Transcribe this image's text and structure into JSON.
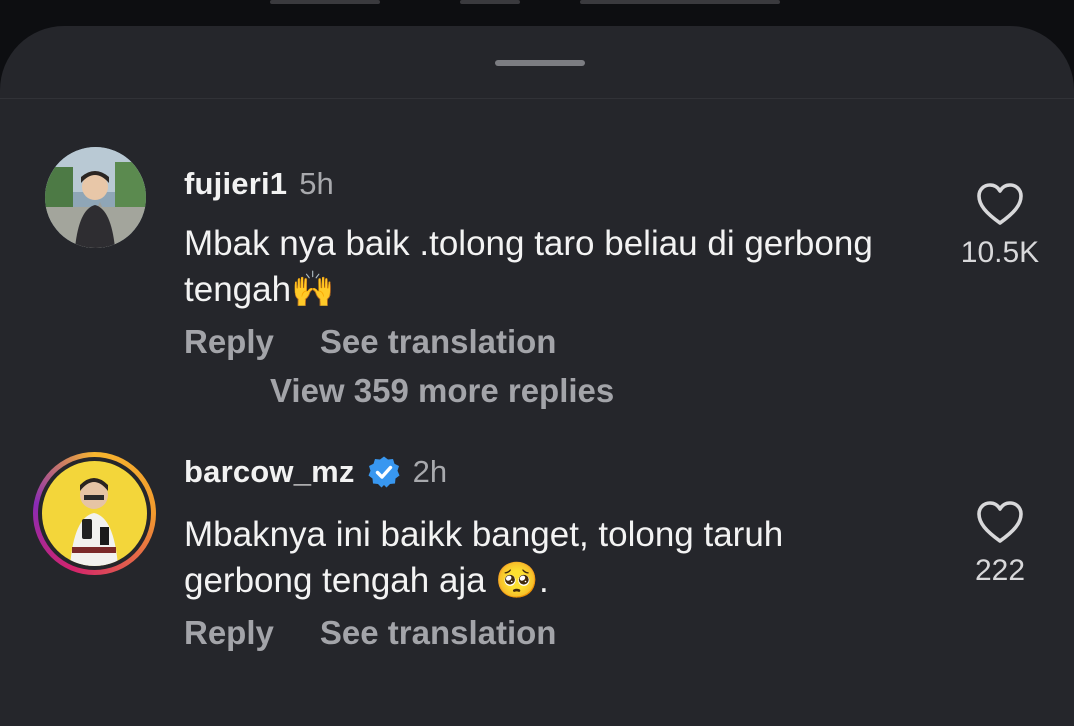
{
  "comments": [
    {
      "username": "fujieri1",
      "time": "5h",
      "text": "Mbak nya baik .tolong taro beliau di gerbong tengah🙌",
      "likes": "10.5K",
      "verified": false,
      "has_story": false
    },
    {
      "username": "barcow_mz",
      "time": "2h",
      "text": "Mbaknya ini baikk banget, tolong taruh gerbong tengah aja 🥺.",
      "likes": "222",
      "verified": true,
      "has_story": true
    }
  ],
  "actions": {
    "reply": "Reply",
    "see_translation": "See translation"
  },
  "view_more_replies": "View 359 more replies",
  "colors": {
    "sheet_bg": "#25262b",
    "page_bg": "#0d0e11",
    "muted_text": "#a3a4a9",
    "verified_blue": "#3897f0",
    "story_ring_yellow": "#f7b52e",
    "story_ring_pink": "#d3246b"
  },
  "icons": {
    "like": "heart-outline-icon",
    "verified": "verified-badge-icon",
    "handle": "drag-handle"
  }
}
